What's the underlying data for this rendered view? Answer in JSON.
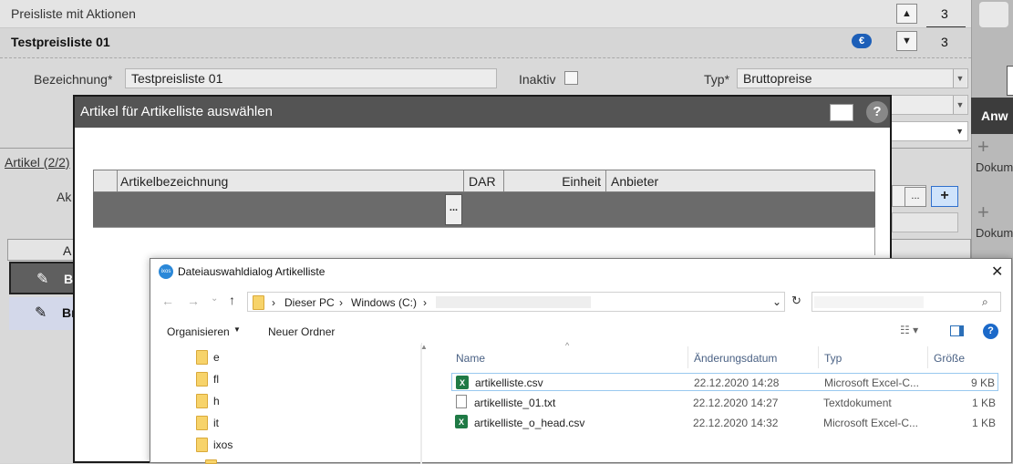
{
  "app": {
    "section_title": "Preisliste mit Aktionen",
    "record_title": "Testpreisliste 01",
    "counter_top": "3",
    "counter_bottom": "3",
    "euro_badge": "€",
    "bezeichnung_label": "Bezeichnung*",
    "bezeichnung_value": "Testpreisliste 01",
    "inaktiv_label": "Inaktiv",
    "typ_label": "Typ*",
    "typ_value": "Bruttopreise",
    "artikel_label": "Artikel (2/2)",
    "ak_label": "Ak",
    "a_col": "A",
    "row1": "Br",
    "row2": "Br",
    "small_btn": "...",
    "right_panel": {
      "anw_label": "Anw",
      "doku1": "Dokum",
      "doku2": "Dokum"
    }
  },
  "modal": {
    "title": "Artikel für Artikelliste auswählen",
    "help": "?",
    "columns": [
      "Artikelbezeichnung",
      "DAR",
      "Einheit",
      "Anbieter"
    ],
    "ellipsis": "..."
  },
  "file_dialog": {
    "title": "Dateiauswahldialog Artikelliste",
    "close": "✕",
    "breadcrumb": [
      "Dieser PC",
      "Windows (C:)"
    ],
    "organize": "Organisieren",
    "new_folder": "Neuer Ordner",
    "tree": [
      "e",
      "fl",
      "h",
      "it",
      "ixos"
    ],
    "columns": {
      "name": "Name",
      "date": "Änderungsdatum",
      "type": "Typ",
      "size": "Größe"
    },
    "files": [
      {
        "name": "artikelliste.csv",
        "date": "22.12.2020 14:28",
        "type": "Microsoft Excel-C...",
        "size": "9 KB",
        "icon": "excel-icon"
      },
      {
        "name": "artikelliste_01.txt",
        "date": "22.12.2020 14:27",
        "type": "Textdokument",
        "size": "1 KB",
        "icon": "text-file-icon"
      },
      {
        "name": "artikelliste_o_head.csv",
        "date": "22.12.2020 14:32",
        "type": "Microsoft Excel-C...",
        "size": "1 KB",
        "icon": "excel-icon"
      }
    ]
  }
}
